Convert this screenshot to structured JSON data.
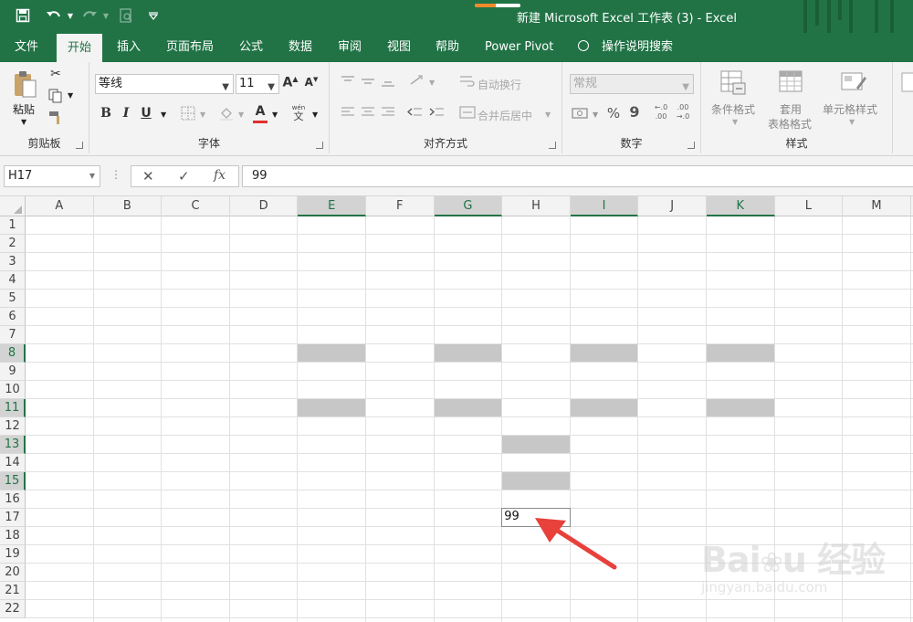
{
  "titlebar": {
    "title": "新建 Microsoft Excel 工作表 (3)  -  Excel",
    "save_icon": "save-icon",
    "undo_icon": "undo-icon",
    "redo_icon": "redo-icon",
    "print_preview_icon": "print-preview-icon",
    "customize_icon": "customize-qat-icon",
    "autosave_progress": 0.46
  },
  "tabs": [
    {
      "label": "文件"
    },
    {
      "label": "开始",
      "active": true
    },
    {
      "label": "插入"
    },
    {
      "label": "页面布局"
    },
    {
      "label": "公式"
    },
    {
      "label": "数据"
    },
    {
      "label": "审阅"
    },
    {
      "label": "视图"
    },
    {
      "label": "帮助"
    },
    {
      "label": "Power Pivot"
    }
  ],
  "tellme": {
    "label": "操作说明搜索"
  },
  "ribbon": {
    "clipboard": {
      "paste_label": "粘贴",
      "group_label": "剪贴板"
    },
    "font": {
      "font_name": "等线",
      "font_size": "11",
      "bold": "B",
      "italic": "I",
      "underline": "U",
      "font_color_glyph": "A",
      "grow_font": "A",
      "shrink_font": "A",
      "group_label": "字体",
      "phonetic_top": "wén",
      "phonetic_bottom": "文"
    },
    "alignment": {
      "wrap_text": "自动换行",
      "merge_center": "合并后居中",
      "group_label": "对齐方式"
    },
    "number": {
      "format": "常规",
      "percent": "%",
      "comma": "9",
      "inc_decimal": "←.0\n.00",
      "dec_decimal": ".00\n→.0",
      "group_label": "数字"
    },
    "styles": {
      "conditional": "条件格式",
      "table_line1": "套用",
      "table_line2": "表格格式",
      "cell_styles": "单元格样式",
      "group_label": "样式"
    }
  },
  "formula_bar": {
    "name_box": "H17",
    "cancel": "✕",
    "enter": "✓",
    "fx": "fx",
    "value": "99"
  },
  "grid": {
    "columns": [
      "A",
      "B",
      "C",
      "D",
      "E",
      "F",
      "G",
      "H",
      "I",
      "J",
      "K",
      "L",
      "M"
    ],
    "highlighted_columns": [
      "E",
      "G",
      "I",
      "K"
    ],
    "rows": [
      "1",
      "2",
      "3",
      "4",
      "5",
      "6",
      "7",
      "8",
      "9",
      "10",
      "11",
      "12",
      "13",
      "14",
      "15",
      "16",
      "17",
      "18",
      "19",
      "20",
      "21",
      "22"
    ],
    "highlighted_rows": [
      "8",
      "11",
      "13",
      "15"
    ],
    "shaded_cells": [
      "E8",
      "G8",
      "I8",
      "K8",
      "E11",
      "G11",
      "I11",
      "K11",
      "H13",
      "H15"
    ],
    "active_cell": {
      "ref": "H17",
      "value": "99"
    }
  },
  "watermark": {
    "logo": "Bai 经验",
    "url": "jingyan.baidu.com"
  },
  "colors": {
    "excel_green": "#217346",
    "shade": "#c7c7c7",
    "arrow": "#e8403a"
  }
}
